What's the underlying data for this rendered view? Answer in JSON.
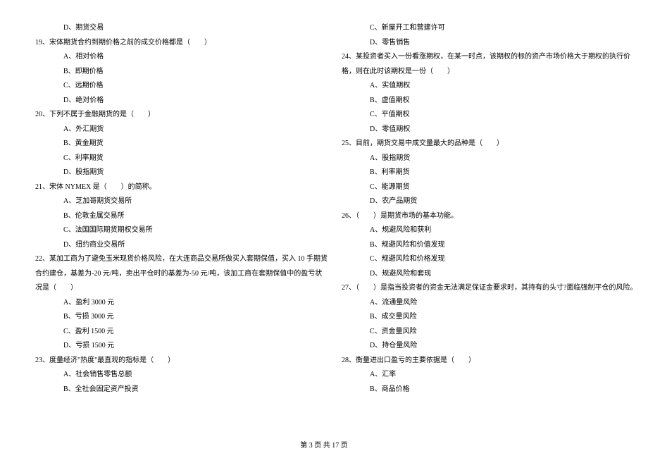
{
  "left": {
    "opt_d_pre": "D、期货交易",
    "q19": "19、宋体期货合约到期价格之前的成交价格都是（　　）",
    "q19_a": "A、相对价格",
    "q19_b": "B、即期价格",
    "q19_c": "C、远期价格",
    "q19_d": "D、绝对价格",
    "q20": "20、下列不属于金融期货的是（　　）",
    "q20_a": "A、外汇期货",
    "q20_b": "B、黄金期货",
    "q20_c": "C、利率期货",
    "q20_d": "D、股指期货",
    "q21": "21、宋体 NYMEX 是（　　）的简称。",
    "q21_a": "A、芝加哥期货交易所",
    "q21_b": "B、伦敦金属交易所",
    "q21_c": "C、法国国际期货期权交易所",
    "q21_d": "D、纽约商业交易所",
    "q22_l1": "22、某加工商为了避免玉米现货价格风险，在大连商品交易所做买入套期保值，买入 10 手期货",
    "q22_l2": "合约建仓，基差为-20 元/吨，卖出平仓时的基差为-50 元/吨，该加工商在套期保值中的盈亏状",
    "q22_l3": "况是（　　）",
    "q22_a": "A、盈利 3000 元",
    "q22_b": "B、亏损 3000 元",
    "q22_c": "C、盈利 1500 元",
    "q22_d": "D、亏损 1500 元",
    "q23": "23、度量经济\"热度\"最直观的指标是（　　）",
    "q23_a": "A、社会销售零售总额",
    "q23_b": "B、全社会固定资产投资"
  },
  "right": {
    "q23_c": "C、新屋开工和营建许可",
    "q23_d": "D、零售销售",
    "q24_l1": "24、某投资者买入一份看涨期权，在某一时点，该期权的标的资产市场价格大于期权的执行价",
    "q24_l2": "格，则在此时该期权是一份（　　）",
    "q24_a": "A、实值期权",
    "q24_b": "B、虚值期权",
    "q24_c": "C、平值期权",
    "q24_d": "D、零值期权",
    "q25": "25、目前，期货交易中成交量最大的品种是（　　）",
    "q25_a": "A、股指期货",
    "q25_b": "B、利率期货",
    "q25_c": "C、能源期货",
    "q25_d": "D、农产品期货",
    "q26": "26、（　　）是期货市场的基本功能。",
    "q26_a": "A、规避风险和获利",
    "q26_b": "B、规避风险和价值发现",
    "q26_c": "C、规避风险和价格发现",
    "q26_d": "D、规避风险和套现",
    "q27": "27、（　　）是指当投资者的资金无法满足保证金要求时，其持有的头寸?面临强制平仓的风险。",
    "q27_a": "A、流通量风险",
    "q27_b": "B、成交量风险",
    "q27_c": "C、资金量风险",
    "q27_d": "D、持仓量风险",
    "q28": "28、衡量进出口盈亏的主要依据是（　　）",
    "q28_a": "A、汇率",
    "q28_b": "B、商品价格"
  },
  "footer": "第 3 页 共 17 页"
}
